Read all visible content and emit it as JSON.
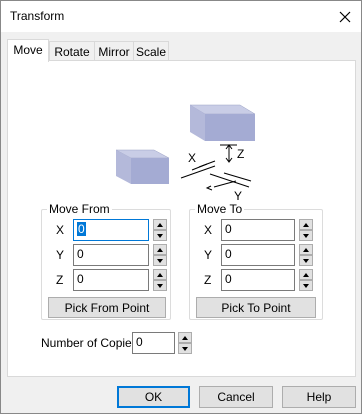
{
  "window": {
    "title": "Transform"
  },
  "tabs": [
    {
      "label": "Move"
    },
    {
      "label": "Rotate"
    },
    {
      "label": "Mirror"
    },
    {
      "label": "Scale"
    }
  ],
  "diagram": {
    "x_label": "X",
    "y_label": "Y",
    "z_label": "Z"
  },
  "move_from": {
    "title": "Move From",
    "x_label": "X",
    "x_value": "0",
    "y_label": "Y",
    "y_value": "0",
    "z_label": "Z",
    "z_value": "0",
    "pick_label": "Pick From Point"
  },
  "move_to": {
    "title": "Move To",
    "x_label": "X",
    "x_value": "0",
    "y_label": "Y",
    "y_value": "0",
    "z_label": "Z",
    "z_value": "0",
    "pick_label": "Pick To Point"
  },
  "copies": {
    "label": "Number of Copies",
    "value": "0"
  },
  "buttons": {
    "ok": "OK",
    "cancel": "Cancel",
    "help": "Help"
  },
  "icons": {
    "close": "close-icon",
    "spin_up": "spin-up-icon",
    "spin_down": "spin-down-icon"
  },
  "colors": {
    "accent": "#0078d7",
    "box_top": "#c9cde6",
    "box_front": "#9ea6cf"
  }
}
